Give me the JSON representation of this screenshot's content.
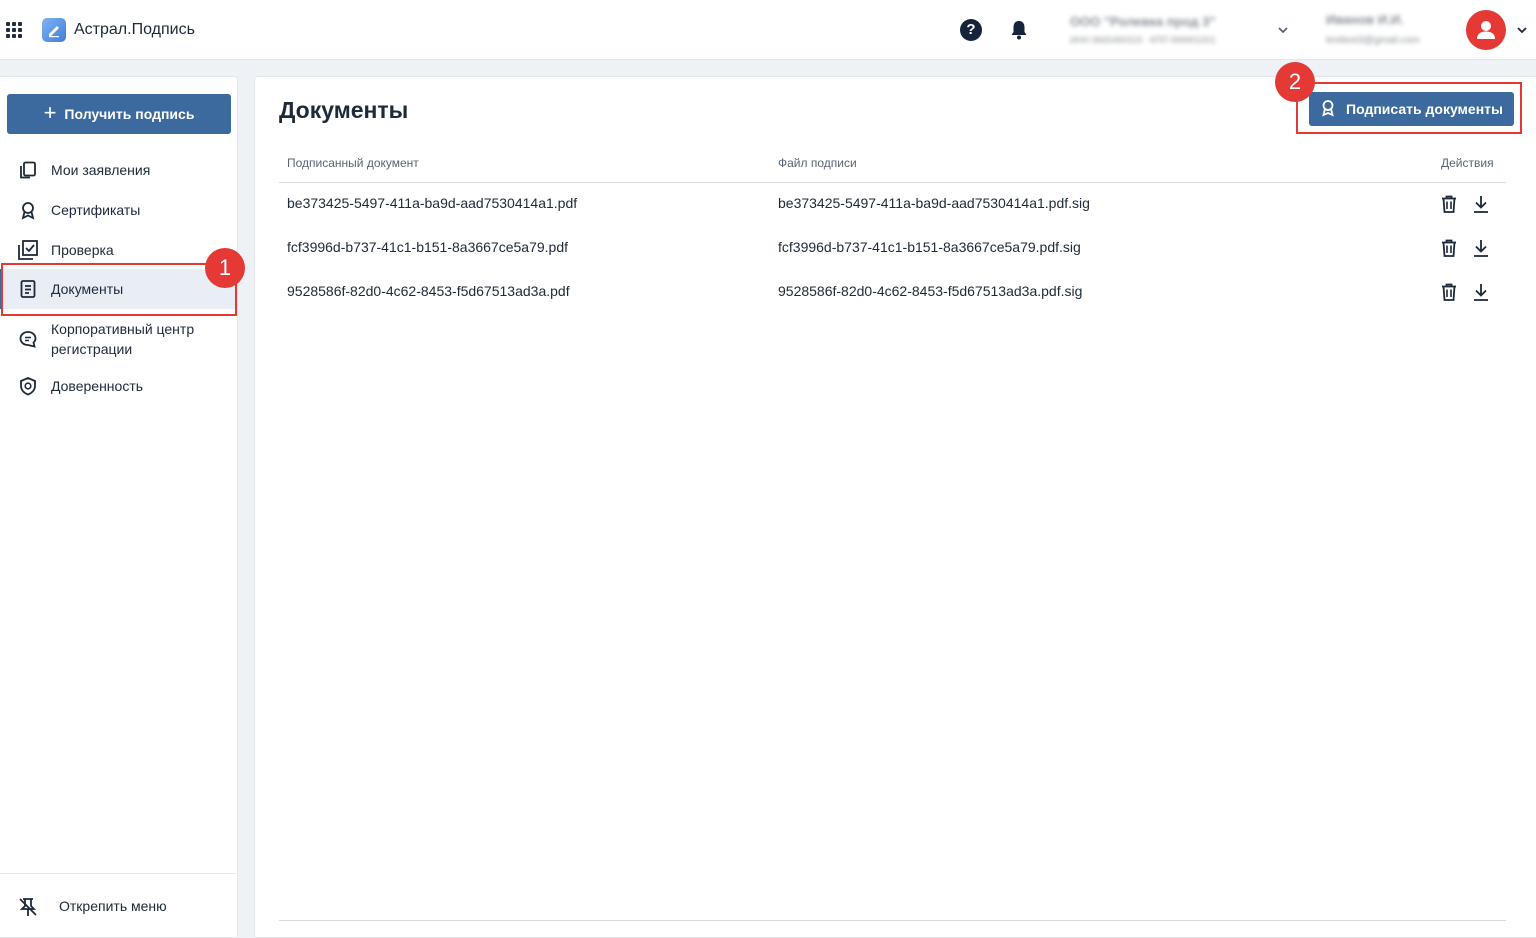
{
  "header": {
    "app_title": "Астрал.Подпись",
    "org_name": "ООО \"Ролевка прод 3\"",
    "org_details": "ИНН 9665490319 · КПП 999901001",
    "user_name": "Иванов И.И.",
    "user_email": "testtest3@gmail.com",
    "icons": [
      "apps-grid-icon",
      "logo-icon",
      "help-icon",
      "bell-icon",
      "chevron-down-icon",
      "avatar-icon"
    ]
  },
  "sidebar": {
    "get_sign_label": "Получить подпись",
    "items": [
      {
        "label": "Мои заявления",
        "icon": "copy-icon"
      },
      {
        "label": "Сертификаты",
        "icon": "award-icon"
      },
      {
        "label": "Проверка",
        "icon": "check-list-icon"
      },
      {
        "label": "Документы",
        "icon": "document-icon",
        "active": true
      },
      {
        "label": "Корпоративный центр регистрации",
        "icon": "chat-icon"
      },
      {
        "label": "Доверенность",
        "icon": "shield-icon"
      }
    ],
    "unpin_label": "Открепить меню"
  },
  "main": {
    "title": "Документы",
    "sign_button_label": "Подписать документы",
    "columns": {
      "document": "Подписанный документ",
      "signature": "Файл подписи",
      "actions": "Действия"
    },
    "rows": [
      {
        "document": "be373425-5497-411a-ba9d-aad7530414a1.pdf",
        "signature": "be373425-5497-411a-ba9d-aad7530414a1.pdf.sig"
      },
      {
        "document": "fcf3996d-b737-41c1-b151-8a3667ce5a79.pdf",
        "signature": "fcf3996d-b737-41c1-b151-8a3667ce5a79.pdf.sig"
      },
      {
        "document": "9528586f-82d0-4c62-8453-f5d67513ad3a.pdf",
        "signature": "9528586f-82d0-4c62-8453-f5d67513ad3a.pdf.sig"
      }
    ]
  },
  "annotations": {
    "badge_1": "1",
    "badge_2": "2",
    "color": "#e53935"
  },
  "colors": {
    "primary": "#3c6a9e",
    "text": "#1d2a3a",
    "accent_red": "#e53935"
  }
}
